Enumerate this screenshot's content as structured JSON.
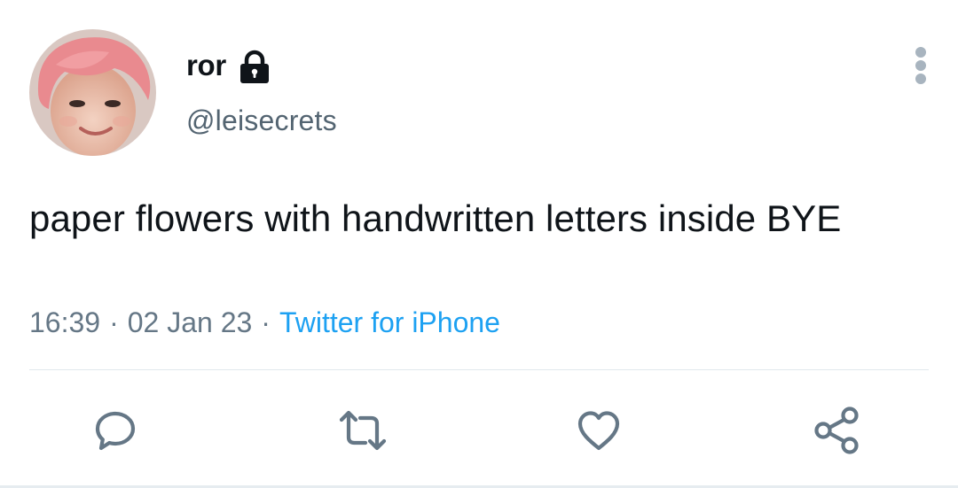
{
  "user": {
    "display_name": "ror",
    "handle": "@leisecrets",
    "protected_icon": "lock-icon",
    "avatar": "profile-photo"
  },
  "tweet": {
    "text": "paper flowers with handwritten letters inside BYE",
    "time": "16:39",
    "date": "02 Jan 23",
    "separator": "·",
    "source": "Twitter for iPhone"
  },
  "actions": [
    {
      "icon": "reply-icon"
    },
    {
      "icon": "retweet-icon"
    },
    {
      "icon": "like-icon"
    },
    {
      "icon": "share-icon"
    }
  ],
  "menu_icon": "more-vertical-icon",
  "colors": {
    "text": "#0f1419",
    "secondary": "#657786",
    "link": "#1da1f2",
    "icon": "#657786",
    "divider": "#e1e8ed"
  }
}
